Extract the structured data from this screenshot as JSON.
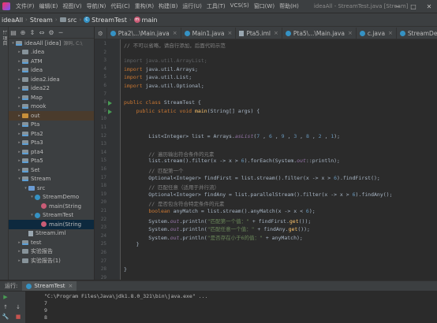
{
  "menubar": {
    "items": [
      "文件(F)",
      "编辑(E)",
      "视图(V)",
      "导航(N)",
      "代码(C)",
      "重构(R)",
      "构建(B)",
      "运行(U)",
      "工具(T)",
      "VCS(S)",
      "窗口(W)",
      "帮助(H)"
    ],
    "title": "ideaAll - StreamTest.java [Stream]"
  },
  "breadcrumb": [
    "ideaAll",
    "Stream",
    "src",
    "StreamTest",
    "main"
  ],
  "sidebar_strip": {
    "label": "1: 项目"
  },
  "tree": [
    {
      "label": "ideaAll [idea]",
      "sub": "源码, C:\\",
      "indent": 0,
      "arrow": "▾",
      "icon": "mod",
      "style": ""
    },
    {
      "label": ".idea",
      "sub": "",
      "indent": 1,
      "arrow": "▸",
      "icon": "plain",
      "style": ""
    },
    {
      "label": "ATM",
      "sub": "",
      "indent": 1,
      "arrow": "▸",
      "icon": "mod",
      "style": ""
    },
    {
      "label": "idea",
      "sub": "",
      "indent": 1,
      "arrow": "▸",
      "icon": "mod",
      "style": ""
    },
    {
      "label": "idea2.idea",
      "sub": "",
      "indent": 1,
      "arrow": "▸",
      "icon": "plain",
      "style": ""
    },
    {
      "label": "idea22",
      "sub": "",
      "indent": 1,
      "arrow": "▸",
      "icon": "mod",
      "style": ""
    },
    {
      "label": "Map",
      "sub": "",
      "indent": 1,
      "arrow": "▸",
      "icon": "mod",
      "style": ""
    },
    {
      "label": "mook",
      "sub": "",
      "indent": 1,
      "arrow": "▸",
      "icon": "mod",
      "style": ""
    },
    {
      "label": "out",
      "sub": "",
      "indent": 1,
      "arrow": "▸",
      "icon": "orange",
      "style": "excluded"
    },
    {
      "label": "Pta",
      "sub": "",
      "indent": 1,
      "arrow": "▸",
      "icon": "mod",
      "style": ""
    },
    {
      "label": "Pta2",
      "sub": "",
      "indent": 1,
      "arrow": "▸",
      "icon": "mod",
      "style": ""
    },
    {
      "label": "Pta3",
      "sub": "",
      "indent": 1,
      "arrow": "▸",
      "icon": "mod",
      "style": ""
    },
    {
      "label": "pta4",
      "sub": "",
      "indent": 1,
      "arrow": "▸",
      "icon": "mod",
      "style": ""
    },
    {
      "label": "Pta5",
      "sub": "",
      "indent": 1,
      "arrow": "▸",
      "icon": "mod",
      "style": ""
    },
    {
      "label": "Set",
      "sub": "",
      "indent": 1,
      "arrow": "▸",
      "icon": "mod",
      "style": ""
    },
    {
      "label": "Stream",
      "sub": "",
      "indent": 1,
      "arrow": "▾",
      "icon": "mod",
      "style": ""
    },
    {
      "label": "src",
      "sub": "",
      "indent": 2,
      "arrow": "▾",
      "icon": "blue",
      "style": ""
    },
    {
      "label": "StreamDemo",
      "sub": "",
      "indent": 3,
      "arrow": "▾",
      "icon": "class",
      "style": ""
    },
    {
      "label": "main(String",
      "sub": "",
      "indent": 4,
      "arrow": "",
      "icon": "method",
      "style": ""
    },
    {
      "label": "StreamTest",
      "sub": "",
      "indent": 3,
      "arrow": "▾",
      "icon": "class",
      "style": ""
    },
    {
      "label": "main(String",
      "sub": "",
      "indent": 4,
      "arrow": "",
      "icon": "method",
      "style": "selected"
    },
    {
      "label": "Stream.iml",
      "sub": "",
      "indent": 2,
      "arrow": "",
      "icon": "iml",
      "style": ""
    },
    {
      "label": "test",
      "sub": "",
      "indent": 1,
      "arrow": "▸",
      "icon": "mod",
      "style": ""
    },
    {
      "label": "实验报告",
      "sub": "",
      "indent": 1,
      "arrow": "▸",
      "icon": "plain",
      "style": ""
    },
    {
      "label": "实验报告(1)",
      "sub": "",
      "indent": 1,
      "arrow": "▸",
      "icon": "plain",
      "style": ""
    }
  ],
  "tabs": [
    {
      "label": "Pta2\\...\\Main.java",
      "icon": "class",
      "active": false
    },
    {
      "label": "Main1.java",
      "icon": "class",
      "active": false
    },
    {
      "label": "Pta5.iml",
      "icon": "iml",
      "active": false
    },
    {
      "label": "Pta5\\...\\Main.java",
      "icon": "class",
      "active": false
    },
    {
      "label": "c.java",
      "icon": "class",
      "active": false
    },
    {
      "label": "StreamDemo.java",
      "icon": "class",
      "active": false
    }
  ],
  "gutter": {
    "line_numbers": [
      "1",
      "2",
      "3",
      "4",
      "5",
      "6",
      "7",
      "8",
      "9",
      "10",
      "11",
      "12",
      "13",
      "14",
      "15",
      "16",
      "17",
      "18",
      "19",
      "20",
      "21",
      "22",
      "23",
      "24",
      "25",
      "26",
      "27",
      "28",
      "29"
    ],
    "run_markers_at": [
      8,
      9
    ]
  },
  "code": [
    [
      [
        "cm",
        "// 不可以省略，请自行添加，后面代码示范"
      ]
    ],
    [],
    [
      [
        "dim",
        "import java.util.ArrayList;"
      ]
    ],
    [
      [
        "kw",
        "import "
      ],
      [
        "",
        "java.util.Arrays;"
      ]
    ],
    [
      [
        "kw",
        "import "
      ],
      [
        "",
        "java.util.List;"
      ]
    ],
    [
      [
        "kw",
        "import "
      ],
      [
        "",
        "java.util.Optional;"
      ]
    ],
    [],
    [
      [
        "kw",
        "public class "
      ],
      [
        "",
        "StreamTest {"
      ]
    ],
    [
      [
        "",
        "    "
      ],
      [
        "kw",
        "public static void "
      ],
      [
        "fn",
        "main"
      ],
      [
        "",
        "(String[] args) {"
      ]
    ],
    [],
    [],
    [
      [
        "",
        "        List<Integer> list = Arrays."
      ],
      [
        "fld",
        "asList"
      ],
      [
        "",
        "("
      ],
      [
        "num",
        "7"
      ],
      [
        "",
        " , "
      ],
      [
        "num",
        "6"
      ],
      [
        "",
        " , "
      ],
      [
        "num",
        "9"
      ],
      [
        "",
        " , "
      ],
      [
        "num",
        "3"
      ],
      [
        "",
        " , "
      ],
      [
        "num",
        "8"
      ],
      [
        "",
        " , "
      ],
      [
        "num",
        "2"
      ],
      [
        "",
        " , "
      ],
      [
        "num",
        "1"
      ],
      [
        "",
        ");"
      ]
    ],
    [],
    [
      [
        "",
        "        "
      ],
      [
        "cm",
        "// 遍历输出符合条件的元素"
      ]
    ],
    [
      [
        "",
        "        list.stream().filter(x -> x > "
      ],
      [
        "num",
        "6"
      ],
      [
        "",
        ").forEach(System."
      ],
      [
        "fld",
        "out"
      ],
      [
        "",
        "::println);"
      ]
    ],
    [
      [
        "",
        "        "
      ],
      [
        "cm",
        "// 匹配第一个"
      ]
    ],
    [
      [
        "",
        "        Optional<Integer> findFirst = list.stream().filter(x -> x > "
      ],
      [
        "num",
        "6"
      ],
      [
        "",
        ").findFirst();"
      ]
    ],
    [
      [
        "",
        "        "
      ],
      [
        "cm",
        "// 匹配任意（适用于并行流）"
      ]
    ],
    [
      [
        "",
        "        Optional<Integer> findAny = list.parallelStream().filter(x -> x > "
      ],
      [
        "num",
        "6"
      ],
      [
        "",
        ").findAny();"
      ]
    ],
    [
      [
        "",
        "        "
      ],
      [
        "cm",
        "// 是否包含符合特定条件的元素"
      ]
    ],
    [
      [
        "",
        "        "
      ],
      [
        "kw",
        "boolean "
      ],
      [
        "",
        "anyMatch = list.stream().anyMatch(x -> x < "
      ],
      [
        "num",
        "6"
      ],
      [
        "",
        ");"
      ]
    ],
    [
      [
        "",
        "        System."
      ],
      [
        "fld",
        "out"
      ],
      [
        "",
        ".println("
      ],
      [
        "str",
        "\"匹配第一个值：\""
      ],
      [
        "",
        " + findFirst."
      ],
      [
        "fn",
        "get"
      ],
      [
        "",
        "());"
      ]
    ],
    [
      [
        "",
        "        System."
      ],
      [
        "fld",
        "out"
      ],
      [
        "",
        ".println("
      ],
      [
        "str",
        "\"匹配任意一个值：\""
      ],
      [
        "",
        " + findAny."
      ],
      [
        "fn",
        "get"
      ],
      [
        "",
        "());"
      ]
    ],
    [
      [
        "",
        "        System."
      ],
      [
        "fld",
        "out"
      ],
      [
        "",
        ".println("
      ],
      [
        "str",
        "\"是否存在小于6的值：\""
      ],
      [
        "",
        " + anyMatch);"
      ]
    ],
    [
      [
        "",
        "    }"
      ]
    ],
    [],
    [],
    [
      [
        "",
        "}"
      ]
    ],
    []
  ],
  "run_panel": {
    "label": "运行:",
    "tab": "StreamTest",
    "console": [
      "\"C:\\Program Files\\Java\\jdk1.8.0_321\\bin\\java.exe\" ...",
      "7",
      "9",
      "8"
    ]
  }
}
